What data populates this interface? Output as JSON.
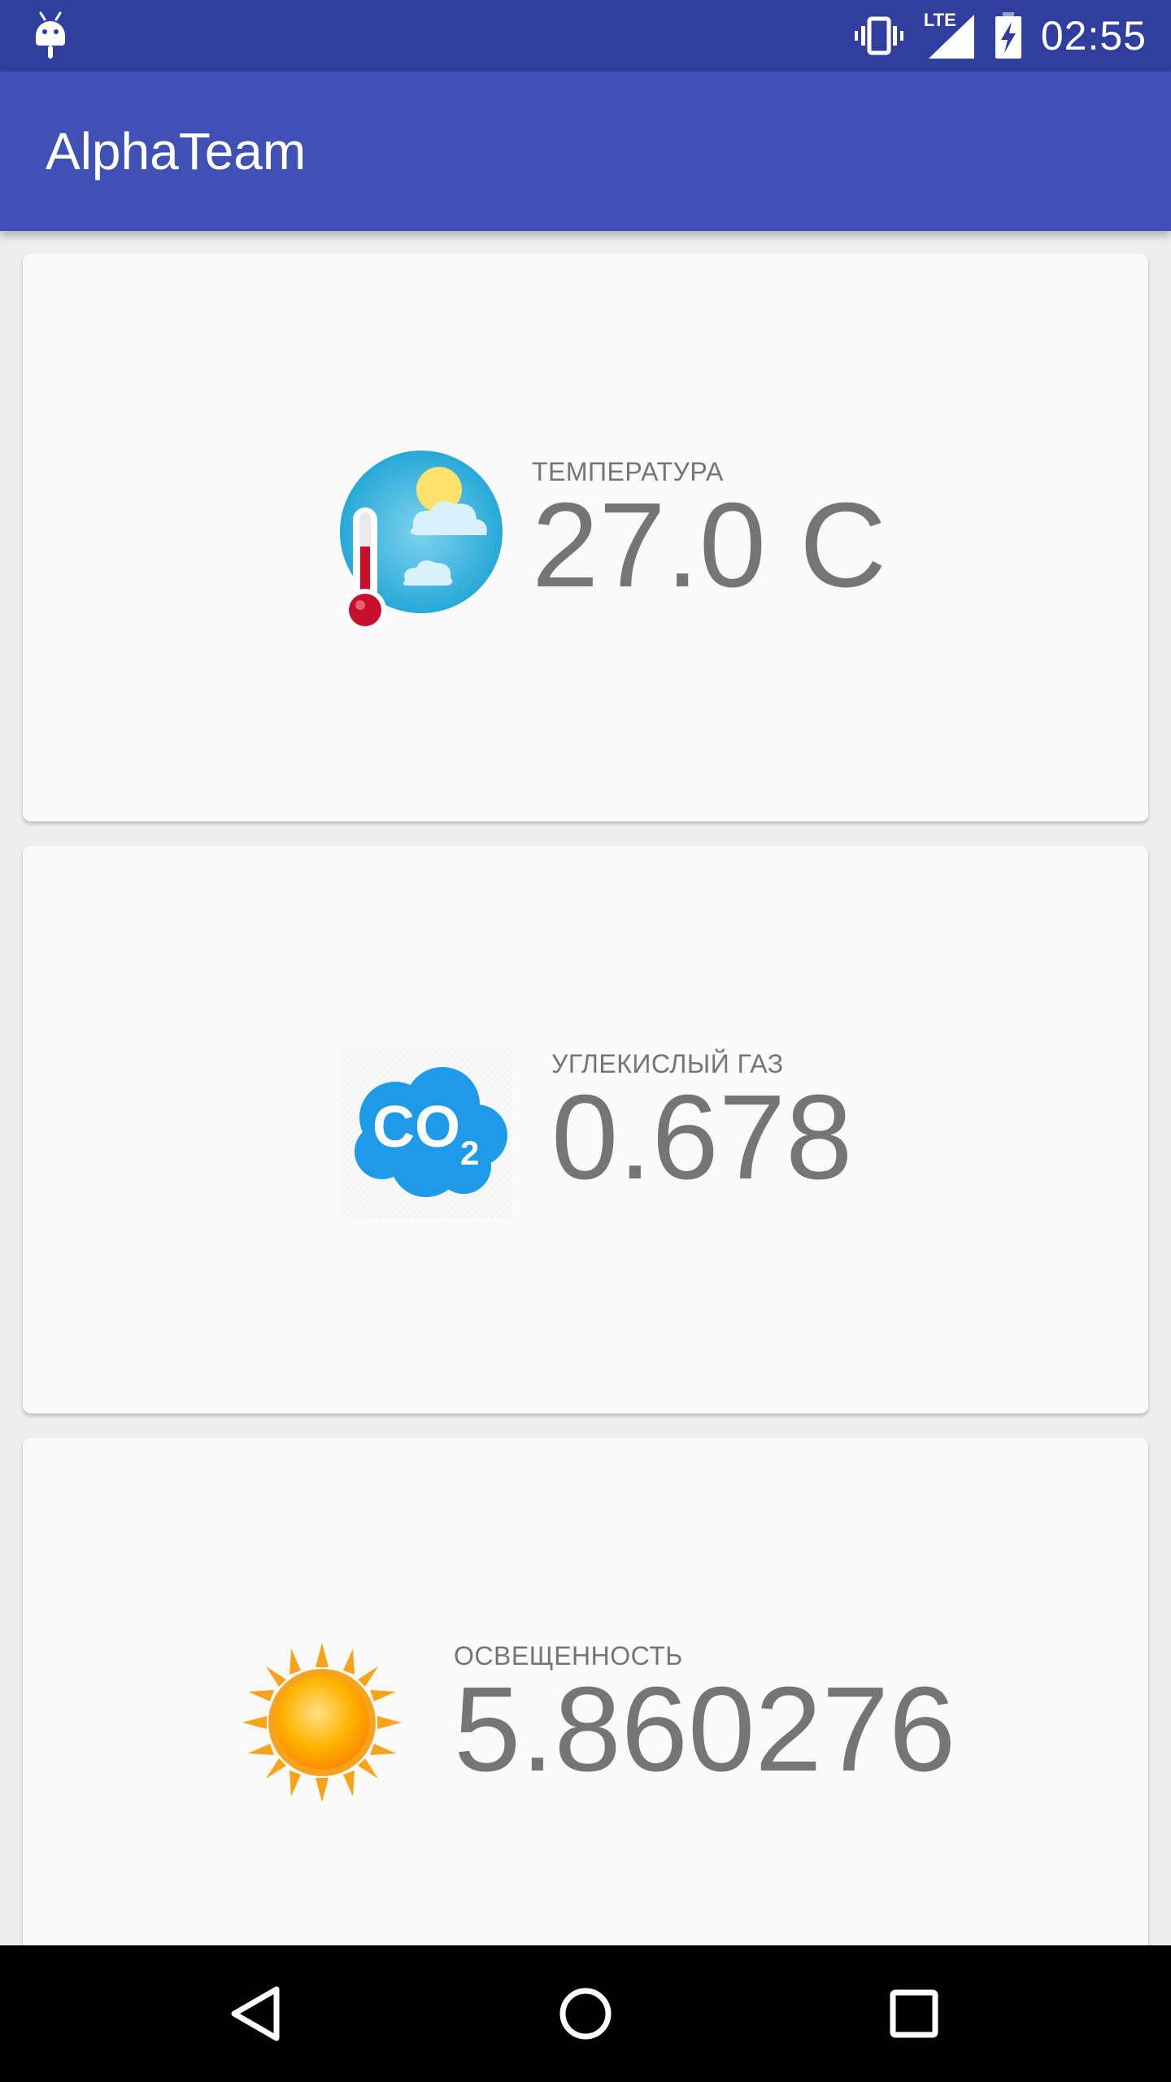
{
  "status_bar": {
    "time": "02:55",
    "network": "LTE",
    "icons": [
      "android-debug-icon",
      "vibrate-icon",
      "signal-icon",
      "battery-charging-icon"
    ]
  },
  "app_bar": {
    "title": "AlphaTeam"
  },
  "cards": [
    {
      "icon": "thermometer-weather-icon",
      "label": "ТЕМПЕРАТУРА",
      "value": "27.0 C"
    },
    {
      "icon": "co2-cloud-icon",
      "label": "УГЛЕКИСЛЫЙ ГАЗ",
      "value": "0.678",
      "icon_text": "CO",
      "icon_subscript": "2"
    },
    {
      "icon": "sun-icon",
      "label": "ОСВЕЩЕННОСТЬ",
      "value": "5.860276"
    }
  ],
  "nav_bar": {
    "buttons": [
      "back-button",
      "home-button",
      "recents-button"
    ]
  },
  "colors": {
    "status_bar": "#303f9f",
    "app_bar": "#3f51b5",
    "card": "#fafafa",
    "text_secondary": "#757575",
    "background": "#eeeeee"
  }
}
